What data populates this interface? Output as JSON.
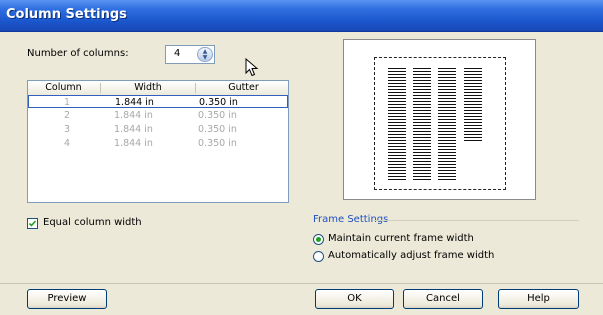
{
  "window": {
    "title": "Column Settings"
  },
  "columns_count": {
    "label": "Number of columns:",
    "value": "4"
  },
  "table": {
    "headers": [
      "Column",
      "Width",
      "Gutter"
    ],
    "rows": [
      {
        "column": "1",
        "width": "1.844 in",
        "gutter": "0.350 in"
      },
      {
        "column": "2",
        "width": "1.844 in",
        "gutter": "0.350 in"
      },
      {
        "column": "3",
        "width": "1.844 in",
        "gutter": "0.350 in"
      },
      {
        "column": "4",
        "width": "1.844 in",
        "gutter": "0.350 in"
      }
    ]
  },
  "equal_width": {
    "label": "Equal column width",
    "checked": true
  },
  "frame_settings": {
    "legend": "Frame Settings",
    "options": [
      {
        "label": "Maintain current frame width",
        "selected": true
      },
      {
        "label": "Automatically adjust frame width",
        "selected": false
      }
    ]
  },
  "buttons": {
    "preview": "Preview",
    "ok": "OK",
    "cancel": "Cancel",
    "help": "Help"
  },
  "colors": {
    "titlebar": "#2f6ee0",
    "dialog_bg": "#ece9d8",
    "legend": "#1f4fbf",
    "radio_dot": "#21a121"
  }
}
